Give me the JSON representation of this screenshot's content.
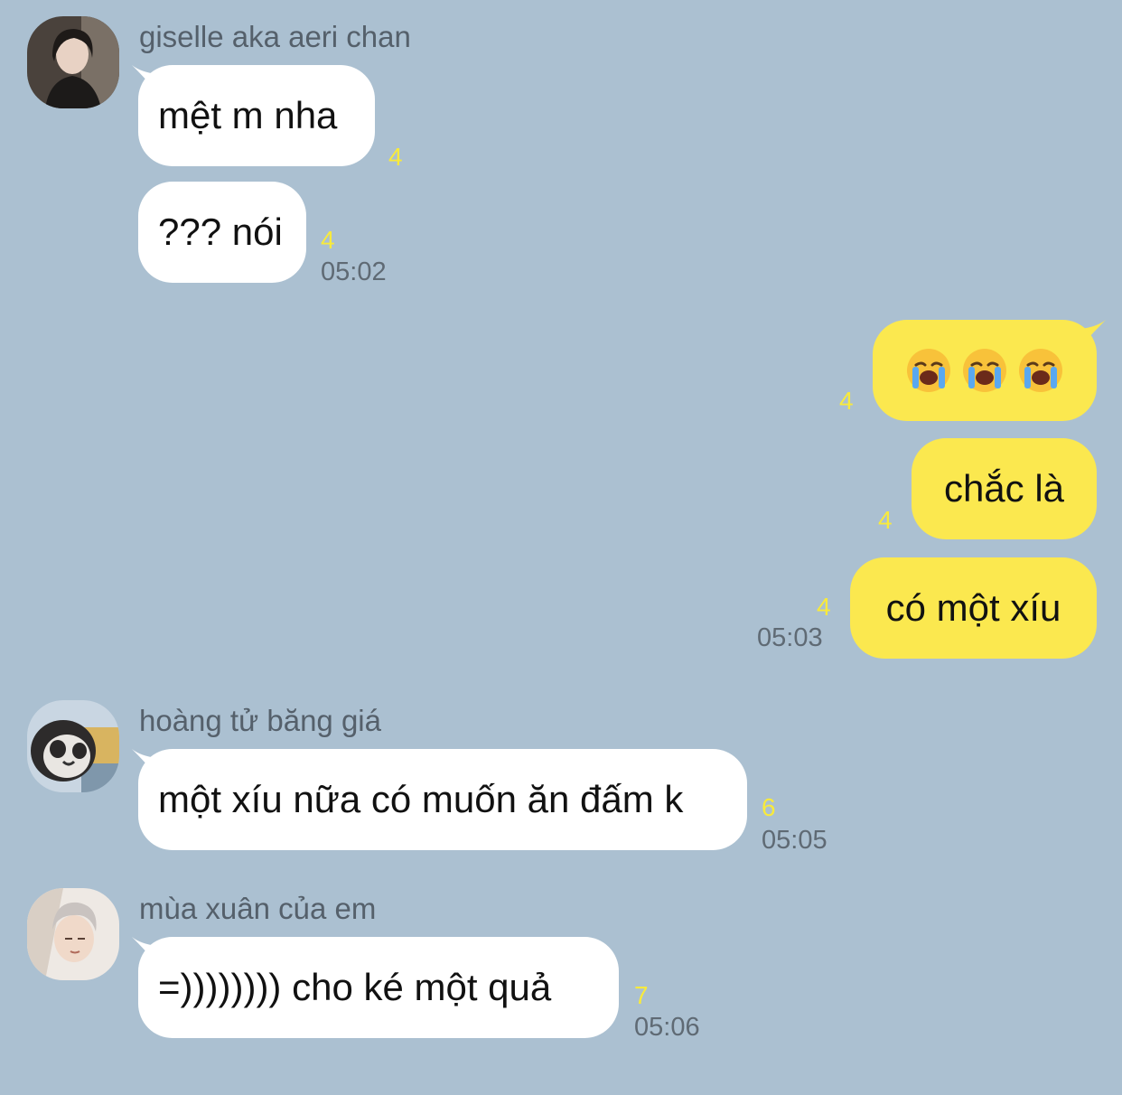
{
  "colors": {
    "background": "#abc0d1",
    "incoming_bubble": "#ffffff",
    "outgoing_bubble": "#fbe84f",
    "unread_count": "#f8ea3c",
    "timestamp": "#5f6a74",
    "sender_name": "#55606b"
  },
  "messages": {
    "group1": {
      "sender": "giselle aka aeri chan",
      "avatar": "avatar-photo-girl",
      "m1": {
        "text": "mệt m nha",
        "count": "4"
      },
      "m2": {
        "text": "??? nói",
        "count": "4"
      },
      "time": "05:02"
    },
    "group2": {
      "m1": {
        "emoji": "loudly-crying-face-icon",
        "count": "4"
      },
      "m2": {
        "text": "chắc là",
        "count": "4"
      },
      "m3": {
        "text": "có một xíu",
        "count": "4"
      },
      "time": "05:03"
    },
    "group3": {
      "sender": "hoàng tử băng giá",
      "avatar": "avatar-penguin",
      "m1": {
        "text": "một xíu nữa có muốn ăn đấm k",
        "count": "6"
      },
      "time": "05:05"
    },
    "group4": {
      "sender": "mùa xuân của em",
      "avatar": "avatar-photo-boy",
      "m1": {
        "text": "=)))))))) cho ké một quả",
        "count": "7"
      },
      "time": "05:06"
    }
  }
}
